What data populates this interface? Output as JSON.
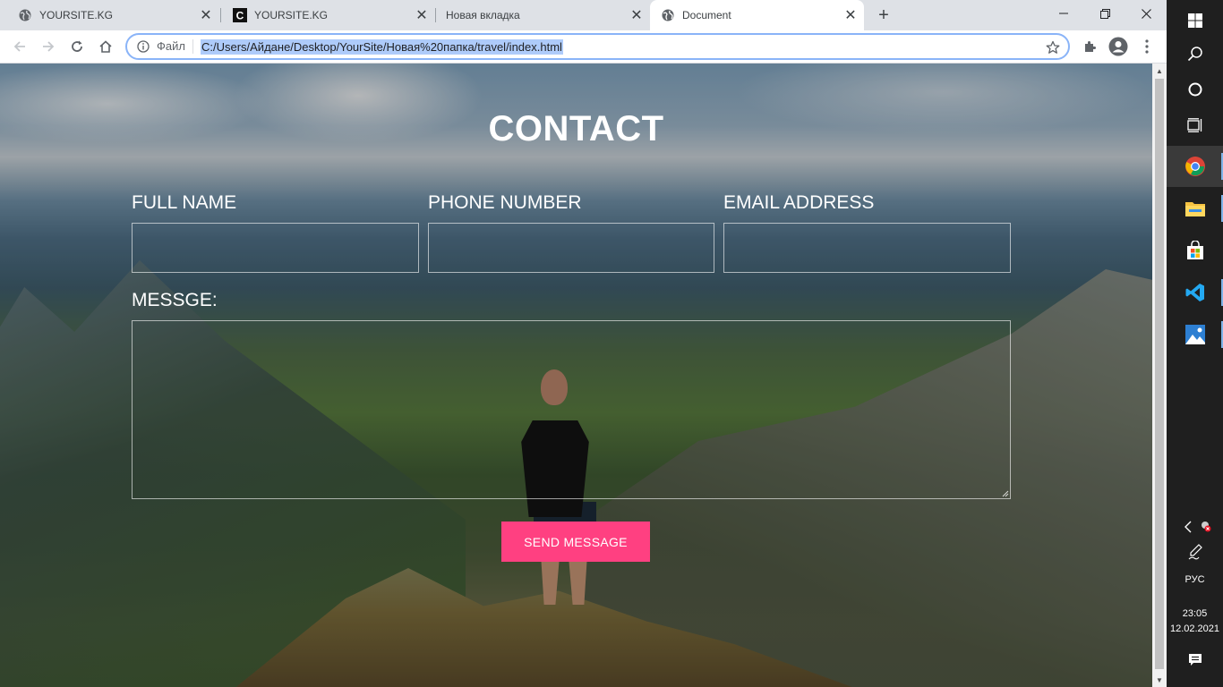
{
  "tabs": [
    {
      "title": "YOURSITE.KG",
      "icon": "globe-icon"
    },
    {
      "title": "YOURSITE.KG",
      "icon": "c-logo-icon"
    },
    {
      "title": "Новая вкладка",
      "icon": null
    },
    {
      "title": "Document",
      "icon": "globe-icon",
      "active": true
    }
  ],
  "omnibox": {
    "scheme_label": "Файл",
    "url": "C:/Users/Айдане/Desktop/YourSite/Новая%20папка/travel/index.html"
  },
  "page": {
    "heading": "CONTACT",
    "fields": {
      "full_name_label": "FULL NAME",
      "phone_label": "PHONE NUMBER",
      "email_label": "EMAIL ADDRESS",
      "message_label": "MESSGE:"
    },
    "send_button": "SEND MESSAGE",
    "accent_color": "#ff4081"
  },
  "taskbar": {
    "language": "РУС",
    "time": "23:05",
    "date": "12.02.2021"
  }
}
